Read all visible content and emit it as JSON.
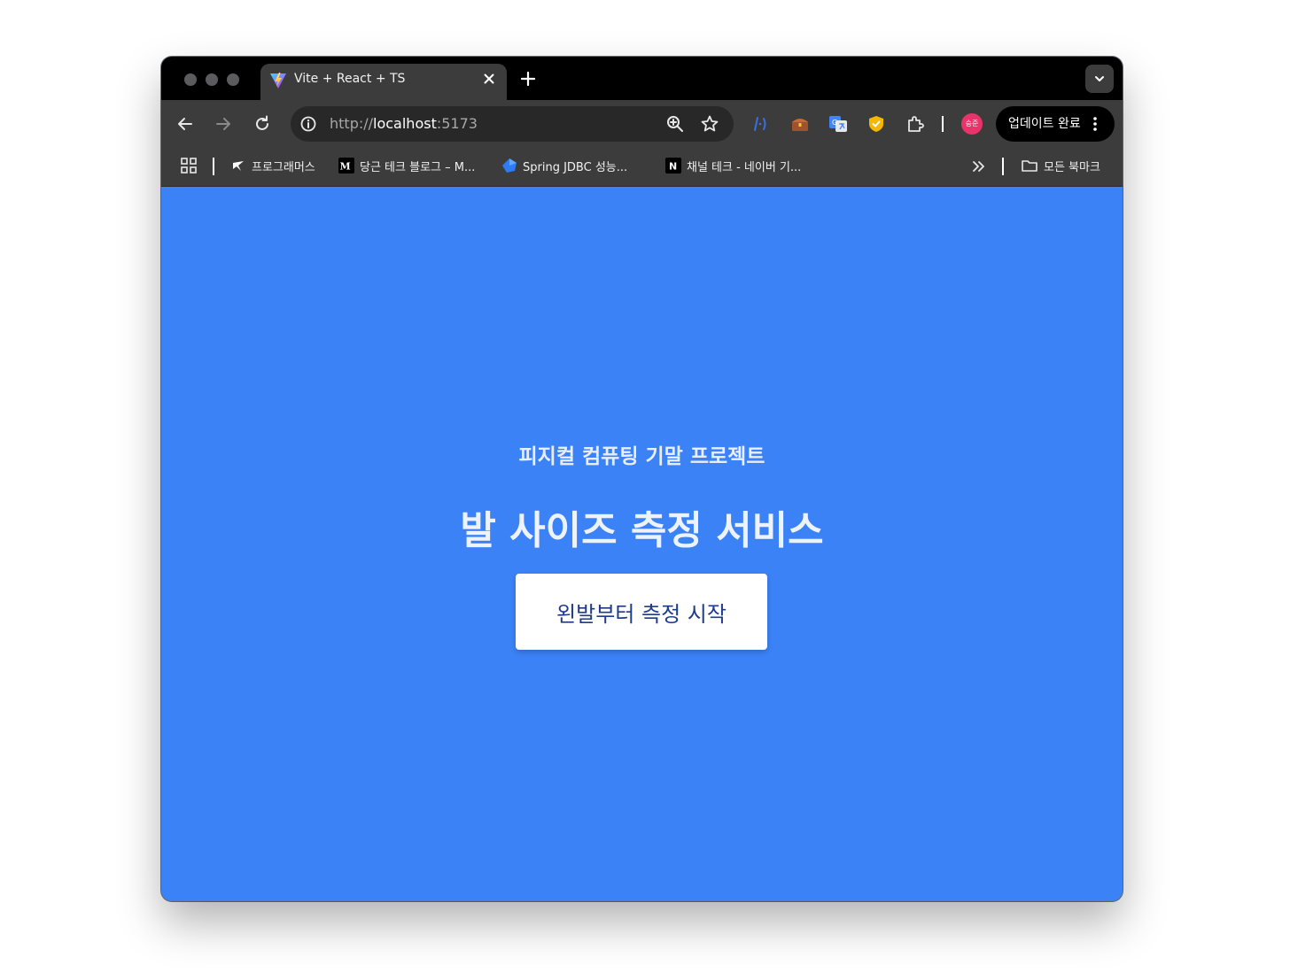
{
  "browser": {
    "tab": {
      "title": "Vite + React + TS",
      "favicon": "vite-icon"
    },
    "url": {
      "scheme": "http://",
      "host": "localhost",
      "port": ":5173"
    },
    "profile_initials": "승준",
    "update_label": "업데이트 완료",
    "bookmarks": [
      {
        "label": "프로그래머스",
        "icon": "programmers-icon"
      },
      {
        "label": "당근 테크 블로그 – M...",
        "icon": "medium-icon"
      },
      {
        "label": "Spring JDBC 성능...",
        "icon": "blue-shape-icon"
      },
      {
        "label": "채널 테크 - 네이버 기...",
        "icon": "notion-icon"
      }
    ],
    "all_bookmarks_label": "모든 북마크"
  },
  "page": {
    "subtitle": "피지컬 컴퓨팅 기말 프로젝트",
    "title": "발 사이즈 측정 서비스",
    "start_button": "왼발부터 측정 시작"
  },
  "colors": {
    "page_background": "#3b82f6",
    "button_text": "#1e3a8a",
    "tab_strip": "#000000",
    "toolbar": "#3c3c3c"
  }
}
